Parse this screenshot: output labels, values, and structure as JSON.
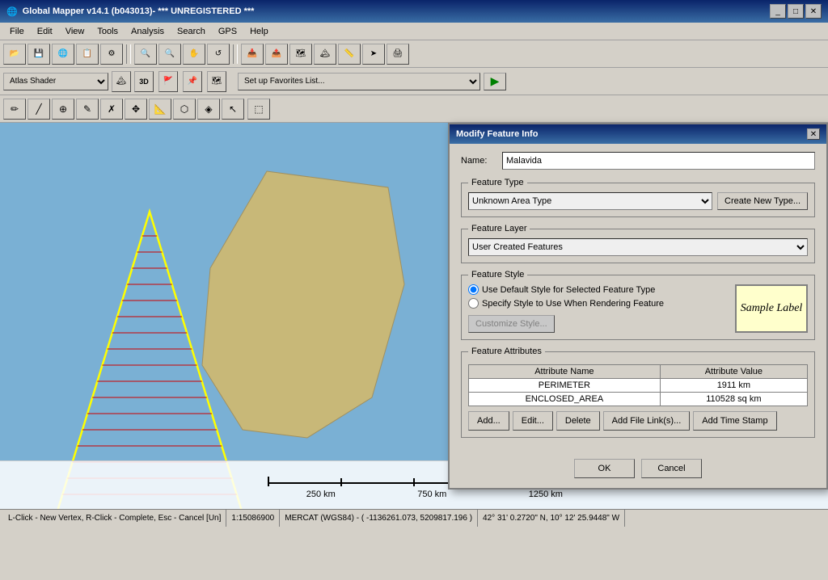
{
  "titlebar": {
    "title": "Global Mapper v14.1 (b043013)- *** UNREGISTERED ***",
    "icon": "globe-icon",
    "controls": [
      "minimize",
      "maximize",
      "close"
    ]
  },
  "menubar": {
    "items": [
      "File",
      "Edit",
      "View",
      "Tools",
      "Analysis",
      "Search",
      "GPS",
      "Help"
    ]
  },
  "toolbar1": {
    "buttons": [
      "open-icon",
      "save-icon",
      "web-icon",
      "layer-icon",
      "settings-icon",
      "zoom-in-icon",
      "zoom-out-icon",
      "refresh-icon",
      "print-icon"
    ]
  },
  "toolbar_shader": {
    "shader_label": "Atlas Shader",
    "shader_options": [
      "Atlas Shader"
    ],
    "icon1": "terrain-icon",
    "icon2": "3d-icon"
  },
  "favorites": {
    "placeholder": "Set up Favorites List...",
    "options": [
      "Set up Favorites List..."
    ]
  },
  "toolbar2": {
    "buttons": [
      "draw-icon",
      "edit-icon",
      "move-icon",
      "delete-icon",
      "split-icon",
      "combine-icon",
      "measure-icon",
      "digitize-icon",
      "vertex-icon",
      "select-icon",
      "flag-icon"
    ]
  },
  "dialog": {
    "title": "Modify Feature Info",
    "name_label": "Name:",
    "name_value": "Malavida",
    "feature_type": {
      "label": "Feature Type",
      "selected": "Unknown Area Type",
      "options": [
        "Unknown Area Type"
      ],
      "create_button": "Create New Type..."
    },
    "feature_layer": {
      "label": "Feature Layer",
      "selected": "User Created Features",
      "options": [
        "User Created Features"
      ]
    },
    "feature_style": {
      "label": "Feature Style",
      "radio1": "Use Default Style for Selected Feature Type",
      "radio2": "Specify Style to Use When Rendering Feature",
      "customize_button": "Customize Style...",
      "sample_label": "Sample Label"
    },
    "feature_attributes": {
      "label": "Feature Attributes",
      "columns": [
        "Attribute Name",
        "Attribute Value"
      ],
      "rows": [
        {
          "name": "PERIMETER",
          "value": "1911 km"
        },
        {
          "name": "ENCLOSED_AREA",
          "value": "110528 sq km"
        }
      ],
      "buttons": [
        "Add...",
        "Edit...",
        "Delete",
        "Add File Link(s)...",
        "Add Time Stamp"
      ]
    },
    "footer": {
      "ok": "OK",
      "cancel": "Cancel"
    }
  },
  "scale_bar": {
    "labels": [
      "",
      "250 km",
      "",
      "750 km",
      "",
      "1250 km"
    ]
  },
  "statusbar": {
    "left": "L-Click - New Vertex, R-Click - Complete, Esc - Cancel [Un]",
    "scale": "1:15086900",
    "projection": "MERCAT (WGS84) - ( -1136261.073, 5209817.196 )",
    "coords": "42° 31' 0.2720\" N, 10° 12' 25.9448\" W"
  }
}
